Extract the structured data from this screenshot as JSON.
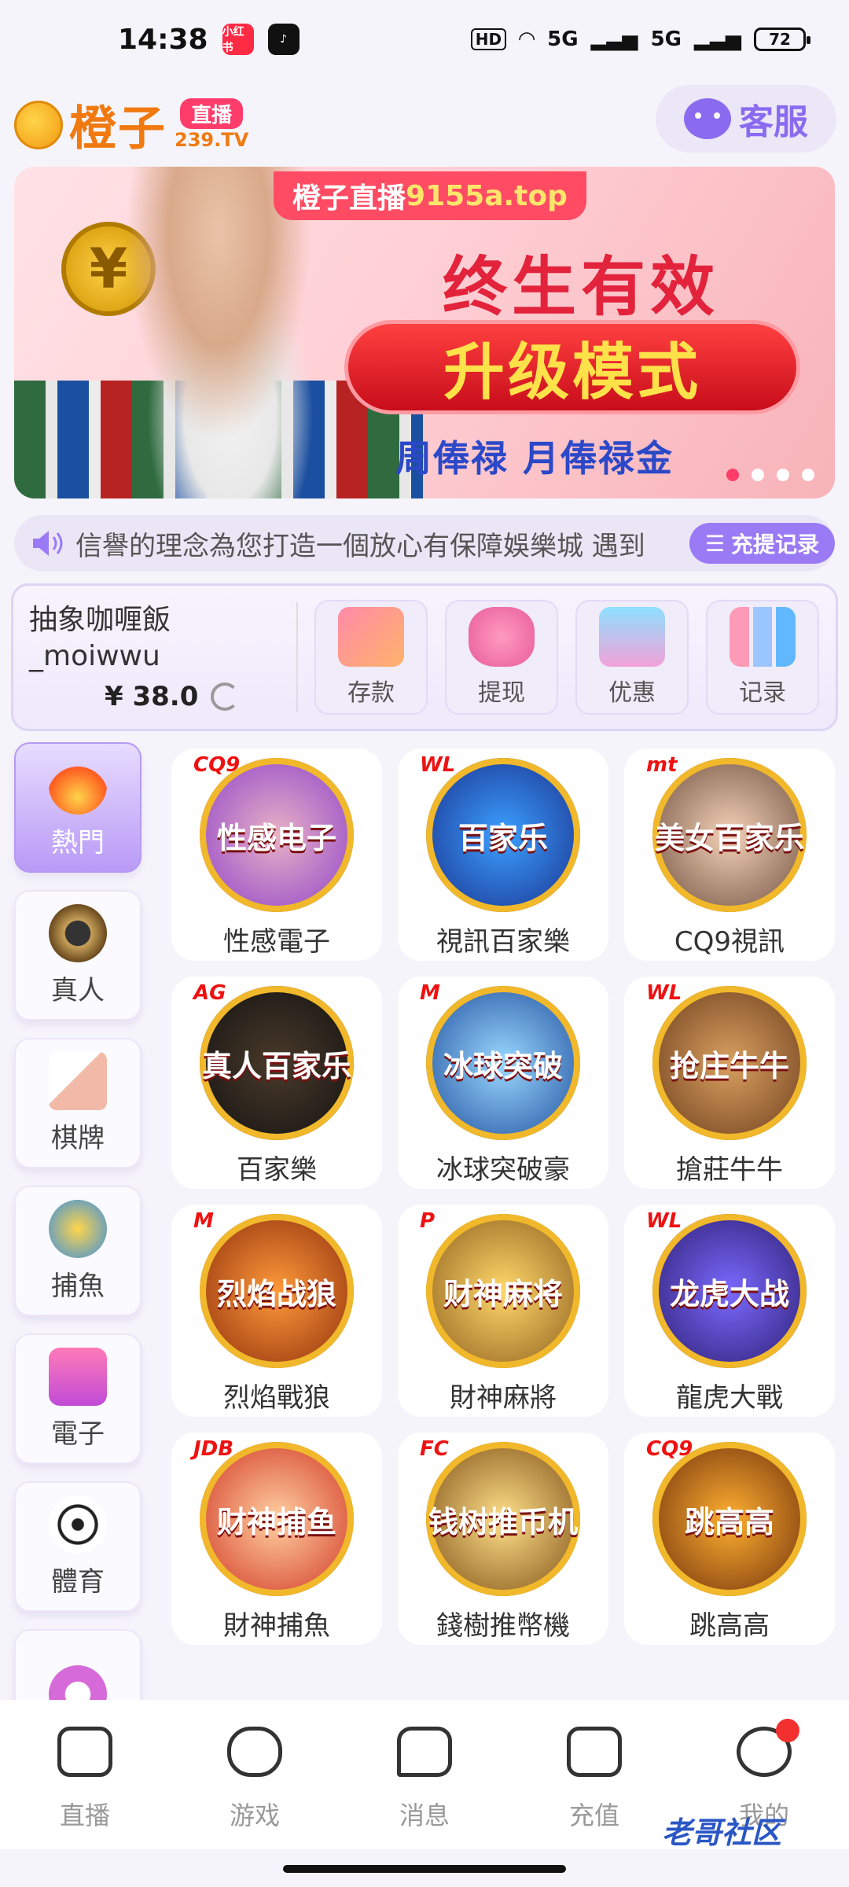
{
  "status_bar": {
    "time": "14:38",
    "app1": "小红书",
    "network": "HD",
    "signal1": "5G",
    "signal2": "5G",
    "battery": "72"
  },
  "header": {
    "logo_text": "橙子",
    "badge_top": "直播",
    "badge_bottom": "239.TV",
    "service_label": "客服"
  },
  "banner": {
    "top_text": "橙子直播",
    "top_url": "9155a.top",
    "headline": "终生有效",
    "button": "升级模式",
    "subline": "周俸禄 月俸禄金"
  },
  "notice": {
    "text": "信譽的理念為您打造一個放心有保障娛樂城  遇到",
    "records_button": "充提记录"
  },
  "wallet": {
    "username_line1": "抽象咖喱飯",
    "username_line2": "_moiwwu",
    "balance": "¥ 38.0",
    "actions": [
      {
        "label": "存款"
      },
      {
        "label": "提现"
      },
      {
        "label": "优惠"
      },
      {
        "label": "记录"
      }
    ]
  },
  "categories": [
    {
      "label": "熱門"
    },
    {
      "label": "真人"
    },
    {
      "label": "棋牌"
    },
    {
      "label": "捕魚"
    },
    {
      "label": "電子"
    },
    {
      "label": "體育"
    }
  ],
  "games": [
    {
      "name": "性感電子",
      "art_text": "性感电子",
      "tag": "CQ9"
    },
    {
      "name": "視訊百家樂",
      "art_text": "百家乐",
      "tag": "WL"
    },
    {
      "name": "CQ9視訊",
      "art_text": "美女百家乐",
      "tag": "mt"
    },
    {
      "name": "百家樂",
      "art_text": "真人百家乐",
      "tag": "AG"
    },
    {
      "name": "冰球突破豪",
      "art_text": "冰球突破",
      "tag": "M"
    },
    {
      "name": "搶莊牛牛",
      "art_text": "抢庄牛牛",
      "tag": "WL"
    },
    {
      "name": "烈焰戰狼",
      "art_text": "烈焰战狼",
      "tag": "M"
    },
    {
      "name": "財神麻將",
      "art_text": "财神麻将",
      "tag": "P"
    },
    {
      "name": "龍虎大戰",
      "art_text": "龙虎大战",
      "tag": "WL"
    },
    {
      "name": "財神捕魚",
      "art_text": "财神捕鱼",
      "tag": "JDB"
    },
    {
      "name": "錢樹推幣機",
      "art_text": "钱树推币机",
      "tag": "FC"
    },
    {
      "name": "跳高高",
      "art_text": "跳高高",
      "tag": "CQ9"
    }
  ],
  "tabbar": [
    {
      "label": "直播"
    },
    {
      "label": "游戏"
    },
    {
      "label": "消息"
    },
    {
      "label": "充值"
    },
    {
      "label": "我的"
    }
  ],
  "watermark": "老哥社区"
}
